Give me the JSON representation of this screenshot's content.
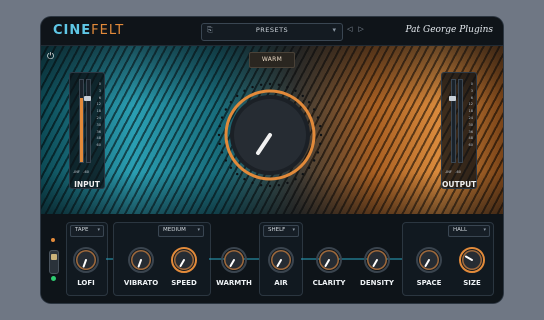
{
  "header": {
    "logo_part1": "CINE",
    "logo_part2": "FELT",
    "preset_label": "PRESETS",
    "brand": "Pat George Plugins"
  },
  "scene": {
    "mode_label": "WARM",
    "input_meter": {
      "label": "INPUT",
      "scale": [
        "0",
        "3",
        "6",
        "12",
        "18",
        "24",
        "30",
        "36",
        "48",
        "60"
      ],
      "foot_left": "-INF",
      "foot_right": "-60",
      "level": 0.78
    },
    "output_meter": {
      "label": "OUTPUT",
      "scale": [
        "0",
        "3",
        "6",
        "12",
        "18",
        "24",
        "30",
        "36",
        "48",
        "60"
      ],
      "foot_left": "-INF",
      "foot_right": "-60",
      "level": 0.0
    }
  },
  "controls": {
    "tape_mode": "TAPE",
    "speed_mode": "MEDIUM",
    "shelf_mode": "SHELF",
    "space_mode": "HALL",
    "knobs": [
      {
        "id": "lofi",
        "label": "LOFI",
        "angle": 200
      },
      {
        "id": "vibrato",
        "label": "VIBRATO",
        "angle": 200
      },
      {
        "id": "speed",
        "label": "SPEED",
        "angle": 210
      },
      {
        "id": "warmth",
        "label": "WARMTH",
        "angle": 210
      },
      {
        "id": "air",
        "label": "AIR",
        "angle": 210
      },
      {
        "id": "clarity",
        "label": "CLARITY",
        "angle": 210
      },
      {
        "id": "density",
        "label": "DENSITY",
        "angle": 210
      },
      {
        "id": "space",
        "label": "SPACE",
        "angle": 210
      },
      {
        "id": "size",
        "label": "SIZE",
        "angle": 300
      }
    ]
  },
  "colors": {
    "accent_orange": "#e28a3a",
    "accent_blue": "#5fc7e6",
    "led_on": "#2ecc71"
  }
}
